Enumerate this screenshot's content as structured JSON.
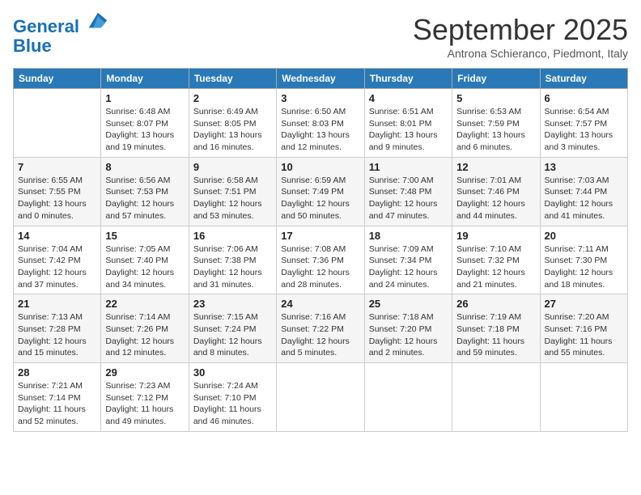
{
  "header": {
    "logo_line1": "General",
    "logo_line2": "Blue",
    "month": "September 2025",
    "location": "Antrona Schieranco, Piedmont, Italy"
  },
  "weekdays": [
    "Sunday",
    "Monday",
    "Tuesday",
    "Wednesday",
    "Thursday",
    "Friday",
    "Saturday"
  ],
  "weeks": [
    [
      {
        "day": "",
        "empty": true
      },
      {
        "day": "1",
        "sunrise": "6:48 AM",
        "sunset": "8:07 PM",
        "daylight": "13 hours and 19 minutes."
      },
      {
        "day": "2",
        "sunrise": "6:49 AM",
        "sunset": "8:05 PM",
        "daylight": "13 hours and 16 minutes."
      },
      {
        "day": "3",
        "sunrise": "6:50 AM",
        "sunset": "8:03 PM",
        "daylight": "13 hours and 12 minutes."
      },
      {
        "day": "4",
        "sunrise": "6:51 AM",
        "sunset": "8:01 PM",
        "daylight": "13 hours and 9 minutes."
      },
      {
        "day": "5",
        "sunrise": "6:53 AM",
        "sunset": "7:59 PM",
        "daylight": "13 hours and 6 minutes."
      },
      {
        "day": "6",
        "sunrise": "6:54 AM",
        "sunset": "7:57 PM",
        "daylight": "13 hours and 3 minutes."
      }
    ],
    [
      {
        "day": "7",
        "sunrise": "6:55 AM",
        "sunset": "7:55 PM",
        "daylight": "13 hours and 0 minutes."
      },
      {
        "day": "8",
        "sunrise": "6:56 AM",
        "sunset": "7:53 PM",
        "daylight": "12 hours and 57 minutes."
      },
      {
        "day": "9",
        "sunrise": "6:58 AM",
        "sunset": "7:51 PM",
        "daylight": "12 hours and 53 minutes."
      },
      {
        "day": "10",
        "sunrise": "6:59 AM",
        "sunset": "7:49 PM",
        "daylight": "12 hours and 50 minutes."
      },
      {
        "day": "11",
        "sunrise": "7:00 AM",
        "sunset": "7:48 PM",
        "daylight": "12 hours and 47 minutes."
      },
      {
        "day": "12",
        "sunrise": "7:01 AM",
        "sunset": "7:46 PM",
        "daylight": "12 hours and 44 minutes."
      },
      {
        "day": "13",
        "sunrise": "7:03 AM",
        "sunset": "7:44 PM",
        "daylight": "12 hours and 41 minutes."
      }
    ],
    [
      {
        "day": "14",
        "sunrise": "7:04 AM",
        "sunset": "7:42 PM",
        "daylight": "12 hours and 37 minutes."
      },
      {
        "day": "15",
        "sunrise": "7:05 AM",
        "sunset": "7:40 PM",
        "daylight": "12 hours and 34 minutes."
      },
      {
        "day": "16",
        "sunrise": "7:06 AM",
        "sunset": "7:38 PM",
        "daylight": "12 hours and 31 minutes."
      },
      {
        "day": "17",
        "sunrise": "7:08 AM",
        "sunset": "7:36 PM",
        "daylight": "12 hours and 28 minutes."
      },
      {
        "day": "18",
        "sunrise": "7:09 AM",
        "sunset": "7:34 PM",
        "daylight": "12 hours and 24 minutes."
      },
      {
        "day": "19",
        "sunrise": "7:10 AM",
        "sunset": "7:32 PM",
        "daylight": "12 hours and 21 minutes."
      },
      {
        "day": "20",
        "sunrise": "7:11 AM",
        "sunset": "7:30 PM",
        "daylight": "12 hours and 18 minutes."
      }
    ],
    [
      {
        "day": "21",
        "sunrise": "7:13 AM",
        "sunset": "7:28 PM",
        "daylight": "12 hours and 15 minutes."
      },
      {
        "day": "22",
        "sunrise": "7:14 AM",
        "sunset": "7:26 PM",
        "daylight": "12 hours and 12 minutes."
      },
      {
        "day": "23",
        "sunrise": "7:15 AM",
        "sunset": "7:24 PM",
        "daylight": "12 hours and 8 minutes."
      },
      {
        "day": "24",
        "sunrise": "7:16 AM",
        "sunset": "7:22 PM",
        "daylight": "12 hours and 5 minutes."
      },
      {
        "day": "25",
        "sunrise": "7:18 AM",
        "sunset": "7:20 PM",
        "daylight": "12 hours and 2 minutes."
      },
      {
        "day": "26",
        "sunrise": "7:19 AM",
        "sunset": "7:18 PM",
        "daylight": "11 hours and 59 minutes."
      },
      {
        "day": "27",
        "sunrise": "7:20 AM",
        "sunset": "7:16 PM",
        "daylight": "11 hours and 55 minutes."
      }
    ],
    [
      {
        "day": "28",
        "sunrise": "7:21 AM",
        "sunset": "7:14 PM",
        "daylight": "11 hours and 52 minutes."
      },
      {
        "day": "29",
        "sunrise": "7:23 AM",
        "sunset": "7:12 PM",
        "daylight": "11 hours and 49 minutes."
      },
      {
        "day": "30",
        "sunrise": "7:24 AM",
        "sunset": "7:10 PM",
        "daylight": "11 hours and 46 minutes."
      },
      {
        "day": "",
        "empty": true
      },
      {
        "day": "",
        "empty": true
      },
      {
        "day": "",
        "empty": true
      },
      {
        "day": "",
        "empty": true
      }
    ]
  ]
}
